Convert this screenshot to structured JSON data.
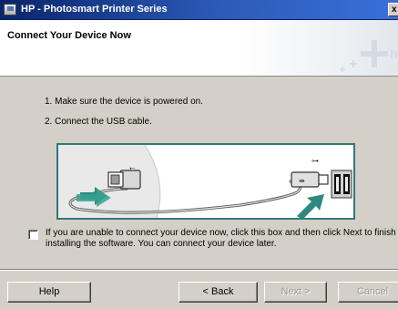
{
  "window": {
    "title": "HP - Photosmart Printer Series",
    "close_glyph": "x"
  },
  "header": {
    "title": "Connect Your Device Now",
    "logo_icon": "hp-plus-logo-icon"
  },
  "instructions": {
    "step1": "1. Make sure the device is powered on.",
    "step2": "2. Connect the USB cable."
  },
  "illustration": {
    "icon": "usb-cable-connection-illustration",
    "accent_color": "#2e7a78"
  },
  "option": {
    "checked": false,
    "label": "If you are unable to connect your device now, click this box and then click Next to finish installing the software. You can connect your device later."
  },
  "buttons": {
    "help": "Help",
    "back": "< Back",
    "next": "Next >",
    "cancel": "Cancel"
  }
}
